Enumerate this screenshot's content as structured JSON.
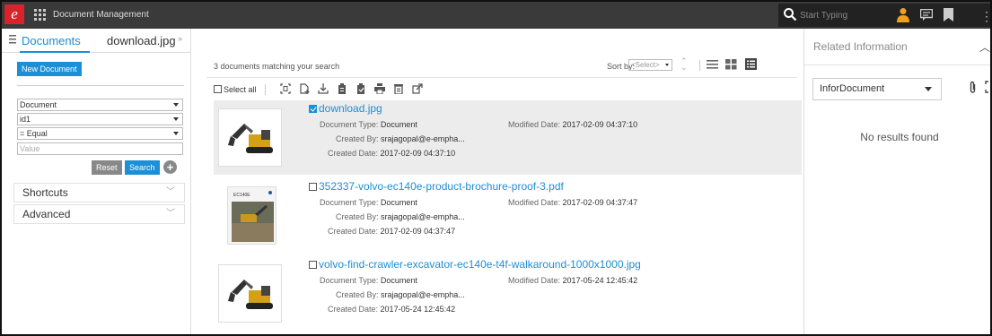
{
  "app": {
    "logo": "e",
    "title": "Document Management",
    "search_placeholder": "Start Typing",
    "accent": "#1c8fd6",
    "brand_red": "#d8232a"
  },
  "tabs": {
    "documents": "Documents",
    "download": "download.jpg",
    "close": "»"
  },
  "left": {
    "new_document": "New Document",
    "filters": {
      "field": "Document",
      "property": "id1",
      "operator": "= Equal",
      "value_placeholder": "Value"
    },
    "reset": "Reset",
    "search": "Search",
    "add": "+",
    "shortcuts": "Shortcuts",
    "advanced": "Advanced"
  },
  "center": {
    "results_text": "3 documents matching your search",
    "sort_label": "Sort by:",
    "sort_value": "<Select>",
    "select_all": "Select all",
    "labels": {
      "type": "Document Type:",
      "created_by": "Created By:",
      "created_date": "Created Date:",
      "modified_date": "Modified Date:"
    },
    "documents": [
      {
        "name": "download.jpg",
        "type": "Document",
        "created_by": "srajagopal@e-empha...",
        "created_date": "2017-02-09 04:37:10",
        "modified_date": "2017-02-09 04:37:10",
        "checked": true,
        "thumb": "excavator"
      },
      {
        "name": "352337-volvo-ec140e-product-brochure-proof-3.pdf",
        "type": "Document",
        "created_by": "srajagopal@e-empha...",
        "created_date": "2017-02-09 04:37:47",
        "modified_date": "2017-02-09 04:37:47",
        "checked": false,
        "thumb": "brochure",
        "thumb_text": "EC140E"
      },
      {
        "name": "volvo-find-crawler-excavator-ec140e-t4f-walkaround-1000x1000.jpg",
        "type": "Document",
        "created_by": "srajagopal@e-empha...",
        "created_date": "2017-05-24 12:45:42",
        "modified_date": "2017-05-24 12:45:42",
        "checked": false,
        "thumb": "excavator"
      }
    ]
  },
  "right": {
    "title": "Related Information",
    "dropdown": "InforDocument",
    "no_results": "No results found"
  }
}
